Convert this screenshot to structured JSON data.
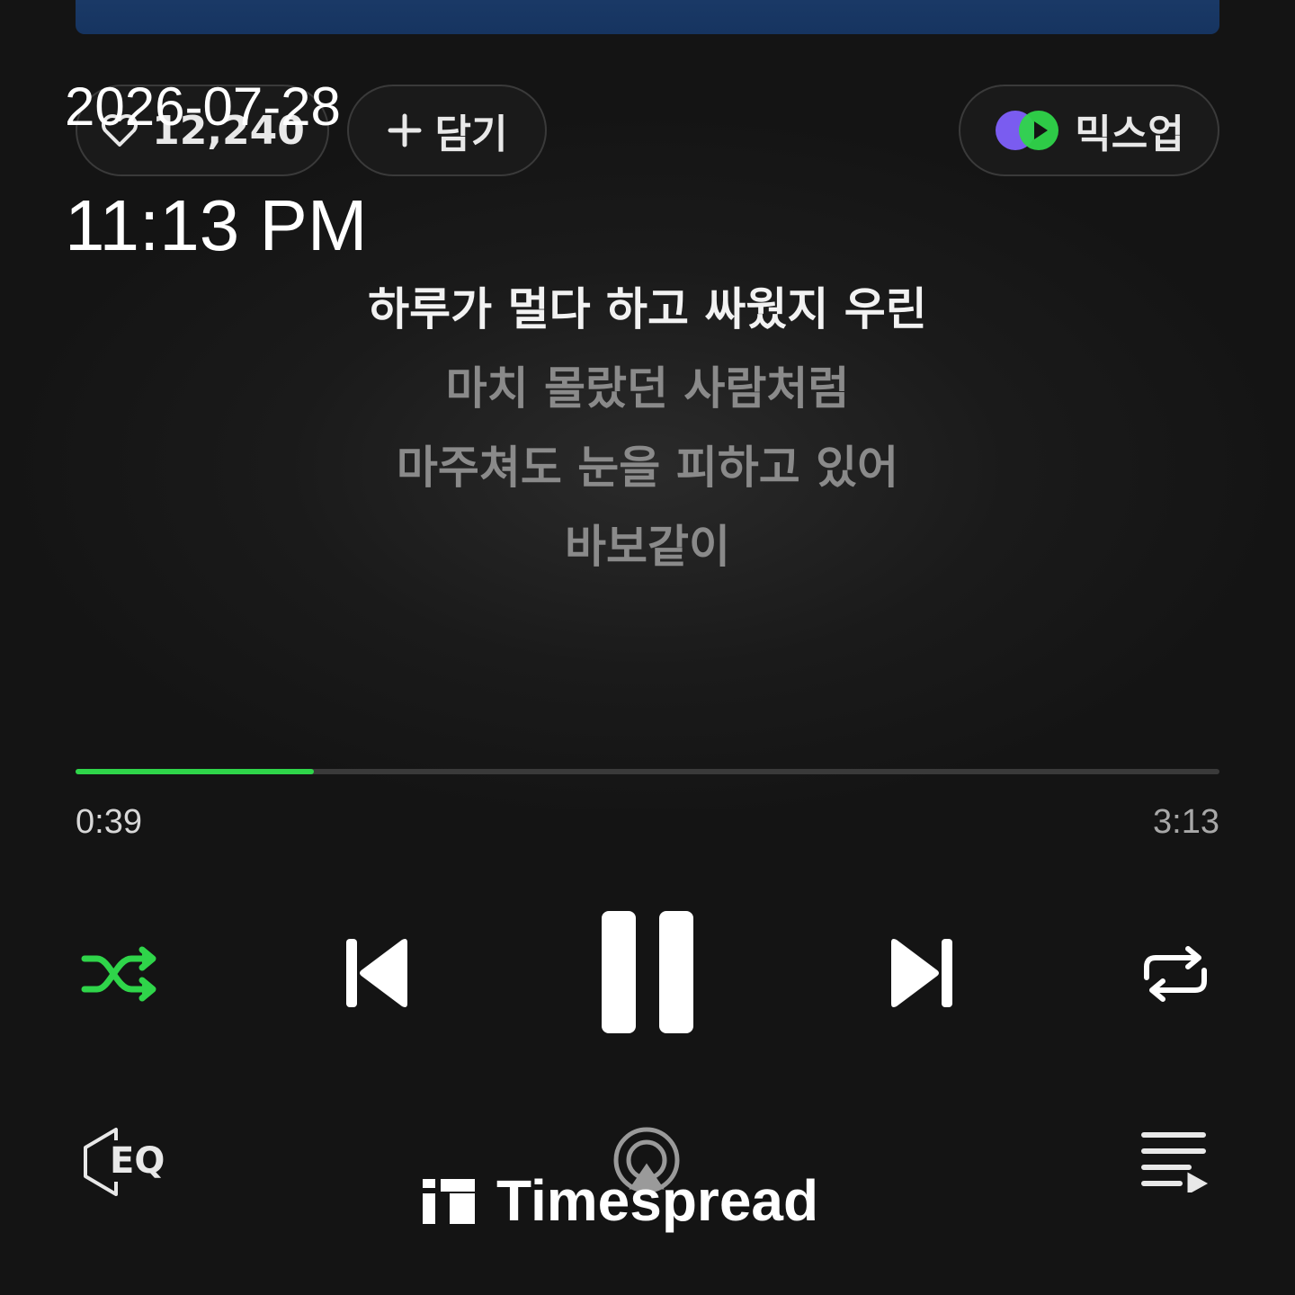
{
  "overlay": {
    "date": "2026-07-28",
    "time": "11:13 PM"
  },
  "actions": {
    "like_count": "12,240",
    "add_label": "담기",
    "mixup_label": "믹스업"
  },
  "lyrics": {
    "lines": [
      "하루가 멀다 하고 싸웠지 우린",
      "마치 몰랐던 사람처럼",
      "마주쳐도 눈을 피하고 있어",
      "바보같이"
    ]
  },
  "playback": {
    "elapsed": "0:39",
    "total": "3:13",
    "progress": 0.208
  },
  "controls": {
    "eq_label": "EQ"
  },
  "watermark": {
    "text": "Timespread"
  },
  "colors": {
    "accent": "#2fd54a",
    "background": "#141414",
    "album_blue": "#1c3c6a"
  },
  "icons": [
    "heart-icon",
    "plus-icon",
    "mixup-icon",
    "shuffle-icon",
    "previous-icon",
    "pause-icon",
    "next-icon",
    "repeat-icon",
    "eq-icon",
    "cast-icon",
    "queue-icon"
  ]
}
